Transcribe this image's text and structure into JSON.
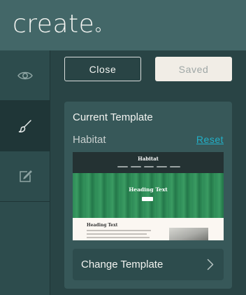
{
  "app": {
    "logo_text": "create"
  },
  "sidebar": {
    "items": [
      {
        "name": "preview",
        "icon": "eye-icon",
        "active": false
      },
      {
        "name": "design",
        "icon": "paintbrush-icon",
        "active": true
      },
      {
        "name": "edit",
        "icon": "edit-icon",
        "active": false
      }
    ]
  },
  "toolbar": {
    "close_label": "Close",
    "saved_label": "Saved"
  },
  "template_card": {
    "title": "Current Template",
    "template_name": "Habitat",
    "reset_label": "Reset",
    "preview": {
      "brand": "Habitat",
      "hero_heading": "Heading Text",
      "body_heading": "Heading Text"
    },
    "change_label": "Change Template"
  },
  "colors": {
    "accent_link": "#22b0c8",
    "topbar_bg": "#436768",
    "panel_bg": "#294445",
    "card_bg": "#375859",
    "saved_bg": "#f1ede6"
  }
}
